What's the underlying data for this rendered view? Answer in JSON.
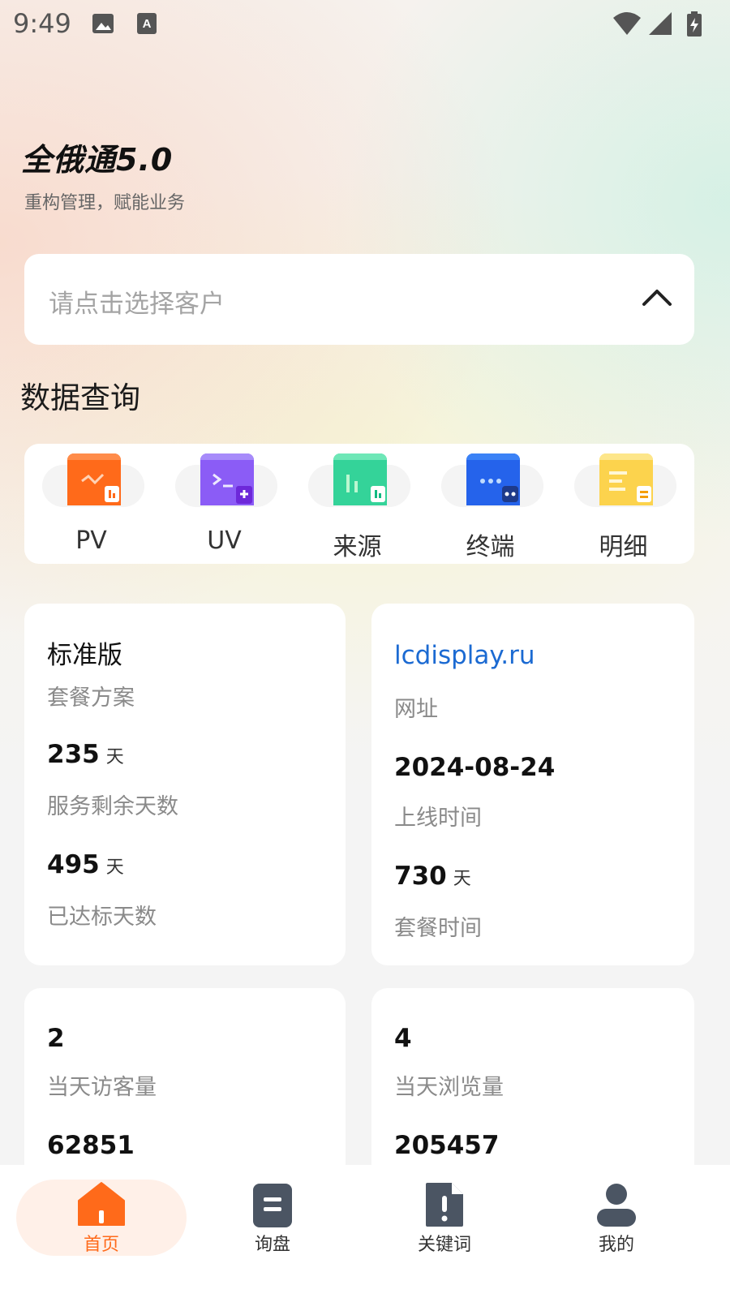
{
  "status_bar": {
    "time": "9:49",
    "icons": [
      "image-icon",
      "font-icon",
      "wifi-icon",
      "signal-icon",
      "battery-icon"
    ]
  },
  "header": {
    "title": "全俄通5.0",
    "subtitle": "重构管理，赋能业务"
  },
  "customer_select": {
    "placeholder": "请点击选择客户",
    "icon": "chevron-up-icon"
  },
  "section": {
    "title": "数据查询"
  },
  "query_items": [
    {
      "label": "PV",
      "color": "#ff6a1a"
    },
    {
      "label": "UV",
      "color": "#8b5cf6"
    },
    {
      "label": "来源",
      "color": "#34d399"
    },
    {
      "label": "终端",
      "color": "#2563eb"
    },
    {
      "label": "明细",
      "color": "#fcd34d"
    }
  ],
  "plan_card": {
    "plan": "标准版",
    "plan_label": "套餐方案",
    "remaining": "235",
    "remaining_unit": "天",
    "remaining_label": "服务剩余天数",
    "achieved": "495",
    "achieved_unit": "天",
    "achieved_label": "已达标天数"
  },
  "site_card": {
    "url": "lcdisplay.ru",
    "url_label": "网址",
    "online_date": "2024-08-24",
    "online_label": "上线时间",
    "package_days": "730",
    "package_unit": "天",
    "package_label": "套餐时间"
  },
  "visitors_card": {
    "today": "2",
    "today_label": "当天访客量",
    "total": "62851"
  },
  "views_card": {
    "today": "4",
    "today_label": "当天浏览量",
    "total": "205457"
  },
  "nav": {
    "items": [
      {
        "label": "首页",
        "icon": "home-icon",
        "active": true
      },
      {
        "label": "询盘",
        "icon": "inquiry-icon",
        "active": false
      },
      {
        "label": "关键词",
        "icon": "keyword-icon",
        "active": false
      },
      {
        "label": "我的",
        "icon": "user-icon",
        "active": false
      }
    ],
    "active_color": "#ff6a1a"
  }
}
